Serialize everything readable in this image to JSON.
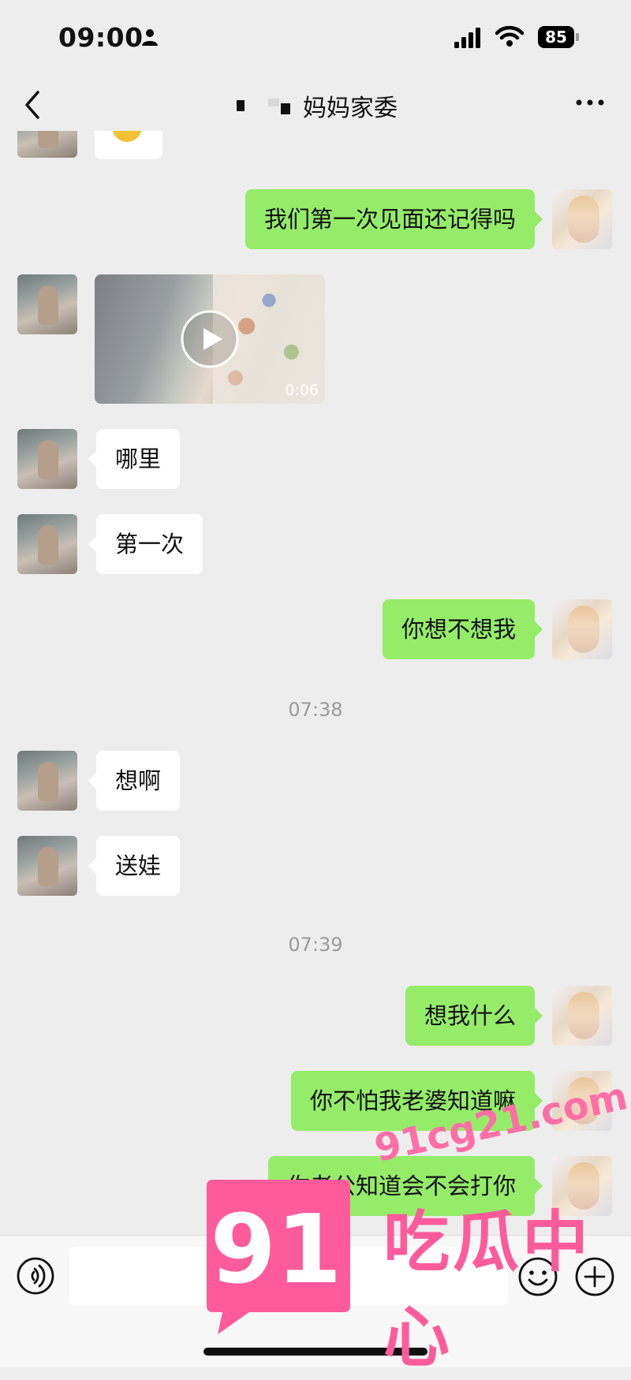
{
  "status_bar": {
    "time": "09:00",
    "battery": "85"
  },
  "nav": {
    "title": "妈妈家委"
  },
  "messages": [
    {
      "side": "right",
      "text": "我们第一次见面还记得吗"
    },
    {
      "side": "left",
      "type": "video",
      "duration": "0:06"
    },
    {
      "side": "left",
      "text": "哪里"
    },
    {
      "side": "left",
      "text": "第一次"
    },
    {
      "side": "right",
      "text": "你想不想我"
    },
    {
      "type": "time",
      "text": "07:38"
    },
    {
      "side": "left",
      "text": "想啊"
    },
    {
      "side": "left",
      "text": "送娃"
    },
    {
      "type": "time",
      "text": "07:39"
    },
    {
      "side": "right",
      "text": "想我什么"
    },
    {
      "side": "right",
      "text": "你不怕我老婆知道嘛"
    },
    {
      "side": "right",
      "text": "你老公知道会不会打你"
    }
  ],
  "watermark": {
    "logo_number": "91",
    "url": "91cg21.com",
    "brand": "吃瓜中心"
  },
  "colors": {
    "background": "#ededed",
    "my_bubble": "#95ec69",
    "friend_bubble": "#ffffff",
    "watermark": "#ff5b9b"
  }
}
